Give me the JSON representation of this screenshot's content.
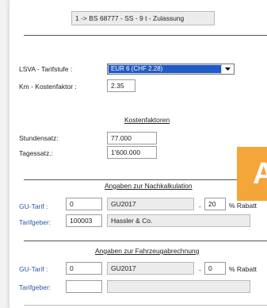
{
  "header": {
    "record": "1 -> BS 68777 - SS - 9 t - Zulassung"
  },
  "lsva": {
    "label": "LSVA - Tarifstufe :",
    "selected": "EUR 6 (CHF 2.28)"
  },
  "km": {
    "label": "Km - Kostenfaktor :",
    "value": "2.35"
  },
  "kosten": {
    "title": "Kostenfaktoren",
    "stunden_label": "Stundensatz:",
    "stunden_value": "77.000",
    "tages_label": "Tagessatz.:",
    "tages_value": "1'600.000"
  },
  "nachkalkulation": {
    "title": "Angaben zur Nachkalkulation",
    "gu_label": "GU-Tarif :",
    "gu_value": "0",
    "gu_name": "GU2017",
    "dash": "-",
    "rabatt_value": "20",
    "rabatt_label": "% Rabatt",
    "tarifgeber_label": "Tarifgeber:",
    "tarifgeber_value": "100003",
    "tarifgeber_name": "Hassler & Co."
  },
  "fahrzeug": {
    "title": "Angaben zur Fahrzeugabrechnung",
    "gu_label": "GU-Tarif :",
    "gu_value": "0",
    "gu_name": "GU2017",
    "dash": "-",
    "rabatt_value": "0",
    "rabatt_label": "% Rabatt",
    "tarifgeber_label": "Tarifgeber:",
    "tarifgeber_value": "",
    "tarifgeber_name": ""
  },
  "badge": {
    "letter": "A",
    "color": "#f4a63a"
  }
}
